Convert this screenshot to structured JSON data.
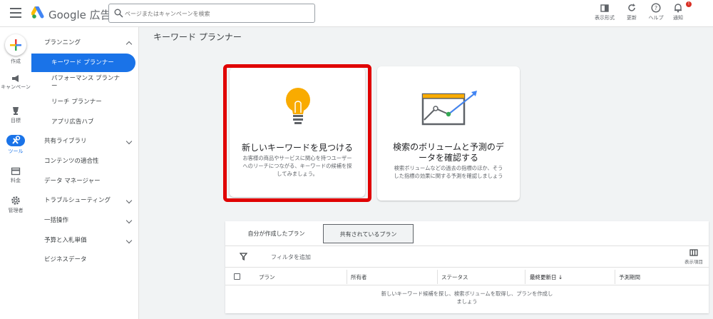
{
  "header": {
    "brand": "Google 広告",
    "search_placeholder": "ページまたはキャンペーンを検索",
    "tools": [
      {
        "label": "表示形式"
      },
      {
        "label": "更新"
      },
      {
        "label": "ヘルプ"
      },
      {
        "label": "通知"
      }
    ],
    "notification_count": "!"
  },
  "rail": {
    "items": [
      {
        "label": "作成"
      },
      {
        "label": "キャンペーン"
      },
      {
        "label": "目標"
      },
      {
        "label": "ツール"
      },
      {
        "label": "料金"
      },
      {
        "label": "管理者"
      }
    ]
  },
  "nav": {
    "items": [
      {
        "label": "プランニング"
      },
      {
        "label": "キーワード プランナー"
      },
      {
        "label": "パフォーマンス プランナー"
      },
      {
        "label": "リーチ プランナー"
      },
      {
        "label": "アプリ広告ハブ"
      },
      {
        "label": "共有ライブラリ"
      },
      {
        "label": "コンテンツの適合性"
      },
      {
        "label": "データ マネージャー"
      },
      {
        "label": "トラブルシューティング"
      },
      {
        "label": "一括操作"
      },
      {
        "label": "予算と入札単価"
      },
      {
        "label": "ビジネスデータ"
      }
    ]
  },
  "page": {
    "title": "キーワード プランナー"
  },
  "cards": {
    "discover": {
      "title": "新しいキーワードを見つける",
      "desc_line1": "お客様の商品やサービスに関心を持つユーザー",
      "desc_line2": "へのリーチにつながる、キーワードの候補を探",
      "desc_line3": "してみましょう。"
    },
    "forecast": {
      "title_line1": "検索のボリュームと予測のデ",
      "title_line2": "ータを確認する",
      "desc_line1": "検索ボリュームなどの過去の指標のほか、そう",
      "desc_line2": "した指標の効果に関する予測を確認しましょう"
    }
  },
  "plans": {
    "tabs": [
      {
        "label": "自分が作成したプラン"
      },
      {
        "label": "共有されているプラン"
      }
    ],
    "filter_label": "フィルタを追加",
    "columns_label": "表示項目",
    "columns": [
      "プラン",
      "所有者",
      "ステータス",
      "最終更新日",
      "予測期間"
    ],
    "sort_indicator": "↓",
    "empty_line1": "新しいキーワード候補を探し、検索ボリュームを取得し、プランを作成し",
    "empty_line2": "ましょう"
  },
  "colors": {
    "accent": "#1a73e8",
    "highlight": "#e00000",
    "bulb": "#f9ab00"
  }
}
